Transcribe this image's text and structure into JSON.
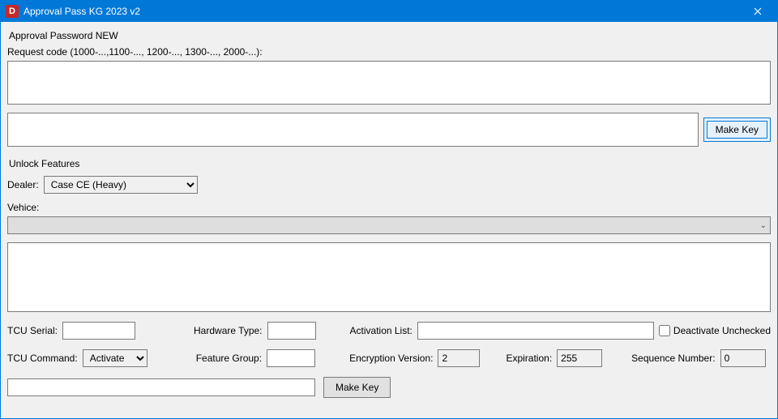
{
  "window": {
    "title": "Approval Pass KG 2023 v2",
    "icon_letter": "D"
  },
  "section1": {
    "title": "Approval Password NEW",
    "request_label": "Request code (1000-...,1100-..., 1200-..., 1300-..., 2000-...):",
    "request_value": "",
    "output_value": "",
    "make_key_label": "Make Key"
  },
  "section2": {
    "title": "Unlock Features",
    "dealer_label": "Dealer:",
    "dealer_value": "Case CE (Heavy)",
    "vehicle_label": "Vehice:",
    "vehicle_value": "",
    "feature_area_value": "",
    "tcu_serial_label": "TCU Serial:",
    "tcu_serial_value": "",
    "hardware_type_label": "Hardware Type:",
    "hardware_type_value": "",
    "activation_list_label": "Activation List:",
    "activation_list_value": "",
    "deactivate_label": "Deactivate Unchecked",
    "deactivate_checked": false,
    "tcu_command_label": "TCU Command:",
    "tcu_command_value": "Activate",
    "feature_group_label": "Feature Group:",
    "feature_group_value": "",
    "encryption_version_label": "Encryption Version:",
    "encryption_version_value": "2",
    "expiration_label": "Expiration:",
    "expiration_value": "255",
    "sequence_number_label": "Sequence Number:",
    "sequence_number_value": "0",
    "bottom_value": "",
    "make_key_label": "Make Key"
  }
}
